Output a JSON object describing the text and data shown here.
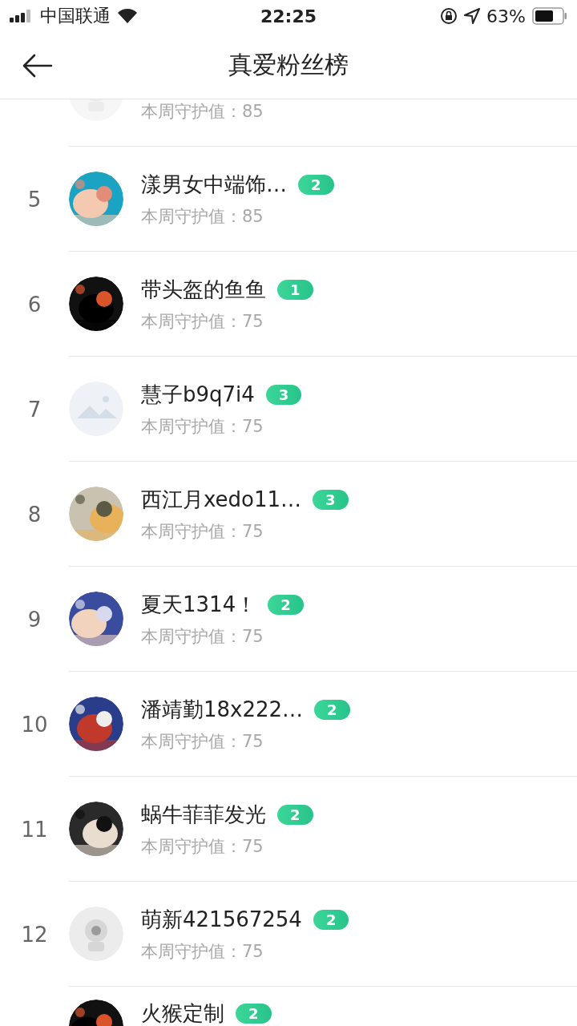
{
  "status_bar": {
    "carrier": "中国联通",
    "time": "22:25",
    "battery": "63%"
  },
  "nav": {
    "title": "真爱粉丝榜"
  },
  "fans": [
    {
      "kind": "default",
      "value": "本周守护值：85"
    },
    {
      "rank": "5",
      "kind": "picture",
      "name": "漾男女中端饰…",
      "badge": "2",
      "value": "本周守护值：85"
    },
    {
      "rank": "6",
      "kind": "picture",
      "name": "带头盔的鱼鱼",
      "badge": "1",
      "value": "本周守护值：75"
    },
    {
      "rank": "7",
      "kind": "placeholder",
      "name": "慧子b9q7i4",
      "badge": "3",
      "value": "本周守护值：75"
    },
    {
      "rank": "8",
      "kind": "picture",
      "name": "西江月xedo11…",
      "badge": "3",
      "value": "本周守护值：75"
    },
    {
      "rank": "9",
      "kind": "picture",
      "name": "夏天1314！",
      "badge": "2",
      "value": "本周守护值：75"
    },
    {
      "rank": "10",
      "kind": "picture",
      "name": "潘靖勤18x222…",
      "badge": "2",
      "value": "本周守护值：75"
    },
    {
      "rank": "11",
      "kind": "picture",
      "name": "蜗牛菲菲发光",
      "badge": "2",
      "value": "本周守护值：75"
    },
    {
      "rank": "12",
      "kind": "default",
      "name": "萌新421567254",
      "badge": "2",
      "value": "本周守护值：75"
    },
    {
      "kind": "picture",
      "name": "火猴定制",
      "badge": "2"
    }
  ]
}
